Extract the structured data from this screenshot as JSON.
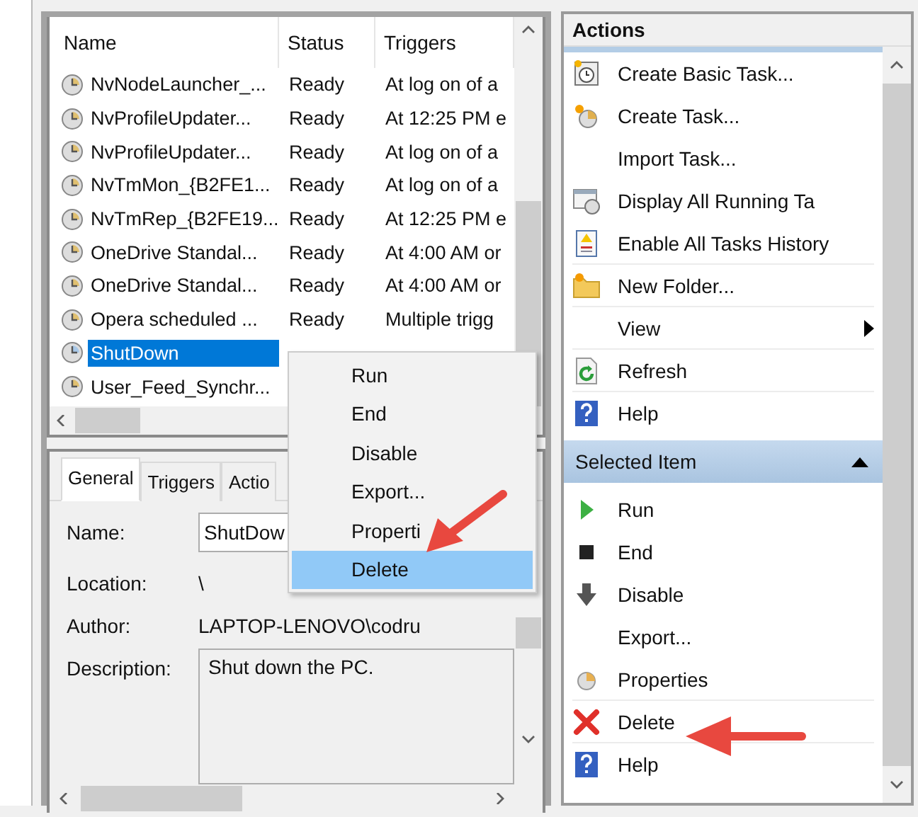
{
  "task_list": {
    "columns": [
      "Name",
      "Status",
      "Triggers"
    ],
    "rows": [
      {
        "name": "NvNodeLauncher_...",
        "status": "Ready",
        "triggers": "At log on of a",
        "selected": false
      },
      {
        "name": "NvProfileUpdater...",
        "status": "Ready",
        "triggers": "At 12:25 PM e",
        "selected": false
      },
      {
        "name": "NvProfileUpdater...",
        "status": "Ready",
        "triggers": "At log on of a",
        "selected": false
      },
      {
        "name": "NvTmMon_{B2FE1...",
        "status": "Ready",
        "triggers": "At log on of a",
        "selected": false
      },
      {
        "name": "NvTmRep_{B2FE19...",
        "status": "Ready",
        "triggers": "At 12:25 PM e",
        "selected": false
      },
      {
        "name": "OneDrive Standal...",
        "status": "Ready",
        "triggers": "At 4:00 AM or",
        "selected": false
      },
      {
        "name": "OneDrive Standal...",
        "status": "Ready",
        "triggers": "At 4:00 AM or",
        "selected": false
      },
      {
        "name": "Opera scheduled ...",
        "status": "Ready",
        "triggers": "Multiple trigg",
        "selected": false
      },
      {
        "name": "ShutDown",
        "selected": true
      },
      {
        "name": "User_Feed_Synchr...",
        "selected": false
      }
    ]
  },
  "details": {
    "tabs": [
      {
        "label": "General",
        "selected": true
      },
      {
        "label": "Triggers",
        "selected": false
      },
      {
        "label": "Actio",
        "selected": false
      }
    ],
    "fields": [
      {
        "label": "Name:",
        "value": "ShutDow",
        "kind": "input"
      },
      {
        "label": "Location:",
        "value": "\\",
        "kind": "text"
      },
      {
        "label": "Author:",
        "value": "LAPTOP-LENOVO\\codru",
        "kind": "text"
      },
      {
        "label": "Description:",
        "value": "Shut down the PC.",
        "kind": "textarea"
      }
    ]
  },
  "context_menu": [
    {
      "label": "Run",
      "selected": false
    },
    {
      "label": "End",
      "selected": false
    },
    {
      "label": "Disable",
      "selected": false
    },
    {
      "label": "Export...",
      "selected": false
    },
    {
      "label": "Properti",
      "selected": false
    },
    {
      "label": "Delete",
      "selected": true
    }
  ],
  "actions": {
    "title": "Actions",
    "items": [
      {
        "label": "Create Basic Task...",
        "kind": "basic",
        "divider_after": false
      },
      {
        "label": "Create Task...",
        "kind": "task",
        "divider_after": false
      },
      {
        "label": "Import Task...",
        "kind": "none",
        "divider_after": false
      },
      {
        "label": "Display All Running Ta",
        "kind": "running",
        "divider_after": false
      },
      {
        "label": "Enable All Tasks History",
        "kind": "history",
        "divider_after": true
      },
      {
        "label": "New Folder...",
        "kind": "folder",
        "divider_after": true
      },
      {
        "label": "View",
        "kind": "submenu",
        "divider_after": true
      },
      {
        "label": "Refresh",
        "kind": "refresh",
        "divider_after": true
      },
      {
        "label": "Help",
        "kind": "help",
        "divider_after": false
      }
    ],
    "section": {
      "title": "Selected Item",
      "expanded": true,
      "items": [
        {
          "label": "Run",
          "kind": "run",
          "divider_after": false
        },
        {
          "label": "End",
          "kind": "end",
          "divider_after": false
        },
        {
          "label": "Disable",
          "kind": "disable",
          "divider_after": false
        },
        {
          "label": "Export...",
          "kind": "none",
          "divider_after": false
        },
        {
          "label": "Properties",
          "kind": "properties",
          "divider_after": true
        },
        {
          "label": "Delete",
          "kind": "delete",
          "divider_after": true
        },
        {
          "label": "Help",
          "kind": "help",
          "divider_after": false
        }
      ]
    }
  }
}
